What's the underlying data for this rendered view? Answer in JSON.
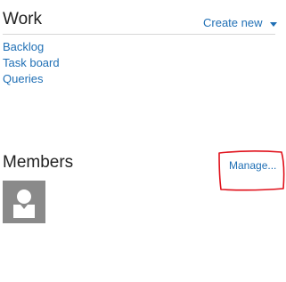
{
  "work": {
    "title": "Work",
    "create_new_label": "Create new",
    "links": [
      {
        "label": "Backlog"
      },
      {
        "label": "Task board"
      },
      {
        "label": "Queries"
      }
    ]
  },
  "members": {
    "title": "Members",
    "manage_label": "Manage...",
    "avatar_icon": "default-user-icon"
  },
  "colors": {
    "link": "#1f6fb5",
    "annotation": "#e0101a",
    "avatar_bg": "#8a8a8a"
  }
}
